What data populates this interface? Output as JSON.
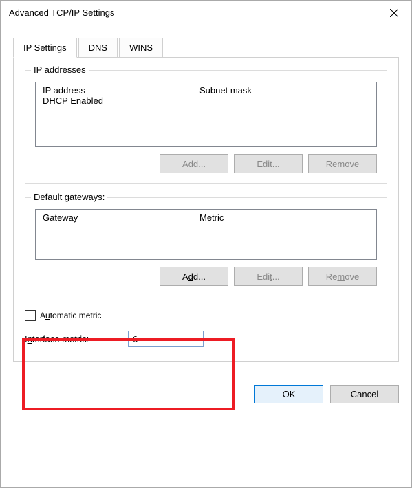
{
  "title": "Advanced TCP/IP Settings",
  "tabs": [
    {
      "label": "IP Settings"
    },
    {
      "label": "DNS"
    },
    {
      "label": "WINS"
    }
  ],
  "ip_addresses": {
    "legend": "IP addresses",
    "col1": "IP address",
    "col2": "Subnet mask",
    "row1": "DHCP Enabled",
    "add": "Add...",
    "edit": "Edit...",
    "remove": "Remove"
  },
  "gateways": {
    "legend": "Default gateways:",
    "col1": "Gateway",
    "col2": "Metric",
    "add": "Add...",
    "edit": "Edit...",
    "remove": "Remove"
  },
  "metric": {
    "auto_label": "Automatic metric",
    "interface_label": "Interface metric:",
    "value": "6"
  },
  "buttons": {
    "ok": "OK",
    "cancel": "Cancel"
  }
}
